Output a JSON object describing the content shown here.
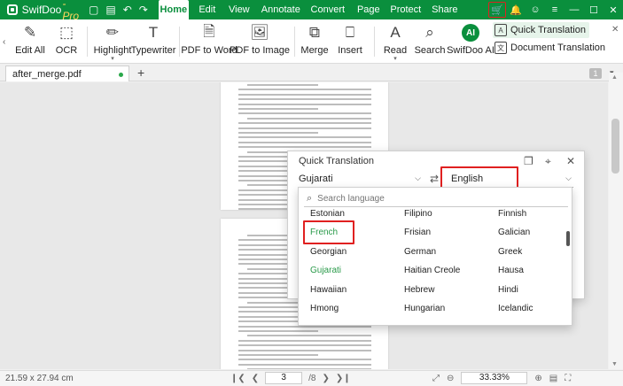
{
  "app": {
    "name": "SwifDoo",
    "edition": "-Pro",
    "quick_access": [
      "▢",
      "▤",
      "↶",
      "↷"
    ]
  },
  "menu": [
    "Home",
    "Edit",
    "View",
    "Annotate",
    "Convert",
    "Page",
    "Protect",
    "Share"
  ],
  "active_menu": "Home",
  "title_icons": [
    "cart-icon",
    "bell-icon",
    "user-icon",
    "menu-icon",
    "minimize-icon",
    "maximize-icon",
    "close-icon"
  ],
  "ribbon": {
    "edit_all": "Edit All",
    "ocr": "OCR",
    "highlight": "Highlight",
    "typewriter": "Typewriter",
    "pdf_to_word": "PDF to Word",
    "pdf_to_image": "PDF to Image",
    "merge": "Merge",
    "insert": "Insert",
    "read": "Read",
    "search": "Search",
    "swifdoo_ai": "SwifDoo AI",
    "ai_badge": "AI",
    "quick_translation": "Quick Translation",
    "document_translation": "Document Translation"
  },
  "tabs": {
    "doc_name": "after_merge.pdf",
    "add": "+",
    "page_badge": "1"
  },
  "status": {
    "page_size": "21.59 x 27.94 cm",
    "current_page": "3",
    "total_pages": "/8",
    "zoom": "33.33%"
  },
  "quick_translation": {
    "title": "Quick Translation",
    "source_lang": "Gujarati",
    "target_lang": "English",
    "search_placeholder": "Search language",
    "languages": [
      [
        "Estonian",
        "Filipino",
        "Finnish"
      ],
      [
        "French",
        "Frisian",
        "Galician"
      ],
      [
        "Georgian",
        "German",
        "Greek"
      ],
      [
        "Gujarati",
        "Haitian Creole",
        "Hausa"
      ],
      [
        "Hawaiian",
        "Hebrew",
        "Hindi"
      ],
      [
        "Hmong",
        "Hungarian",
        "Icelandic"
      ]
    ],
    "highlighted": [
      "French",
      "Gujarati"
    ]
  },
  "colors": {
    "brand": "#0a8f3d",
    "highlight_box": "#e02020",
    "language_green": "#2a9a4a"
  }
}
